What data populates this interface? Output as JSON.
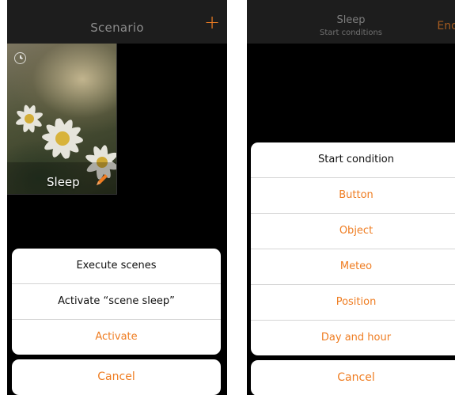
{
  "left_screen": {
    "header": {
      "title": "Scenario",
      "add_icon": "plus-icon"
    },
    "scene": {
      "name": "Sleep",
      "status_icon": "clock-icon",
      "edit_icon": "pencil-icon"
    },
    "action_sheet": {
      "title": "Execute scenes",
      "message": "Activate “scene sleep”",
      "action": "Activate",
      "cancel": "Cancel"
    }
  },
  "right_screen": {
    "header": {
      "title": "Sleep",
      "subtitle": "Start conditions",
      "end_label": "End"
    },
    "action_sheet": {
      "title": "Start condition",
      "options": [
        "Button",
        "Object",
        "Meteo",
        "Position",
        "Day and hour"
      ],
      "cancel": "Cancel"
    }
  },
  "colors": {
    "accent": "#ef7d22",
    "background": "#000000",
    "navbar": "#1d1d1d",
    "sheet": "#ffffff"
  }
}
